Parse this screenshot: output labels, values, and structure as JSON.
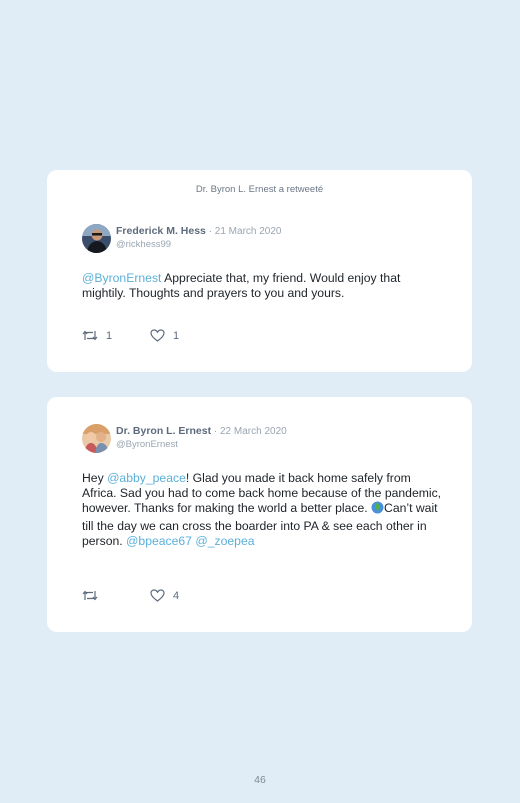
{
  "tweets": [
    {
      "retweet_note": "Dr. Byron L. Ernest a retweeté",
      "author": {
        "name": "Frederick M. Hess",
        "date": " · 21 March 2020",
        "handle": "@rickhess99"
      },
      "text": {
        "m1": "@ByronErnest",
        "t1": " Appreciate that, my friend. Would enjoy that mightily. Thoughts and prayers to you and yours."
      },
      "retweets": "1",
      "likes": "1"
    },
    {
      "author": {
        "name": "Dr. Byron L. Ernest",
        "date": " · 22 March 2020",
        "handle": "@ByronErnest"
      },
      "text": {
        "t1": "Hey ",
        "m1": "@abby_peace",
        "t2": "! Glad you made it back home safely from Africa. Sad you had to come back home because of the pandemic, however. Thanks for making the world a better place. ",
        "emoji_icon": "globe-africa-icon",
        "t3": "Can’t wait till the day we can cross the boarder into PA & see each other in person. ",
        "m2": "@bpeace67",
        "t4": " ",
        "m3": "@_zoepea"
      },
      "likes": "4"
    }
  ],
  "page_number": "46",
  "colors": {
    "background": "#e1edf6",
    "card": "#ffffff",
    "mention": "#5ab0d9",
    "name": "#5d6b7c",
    "meta": "#9aa5b1"
  }
}
